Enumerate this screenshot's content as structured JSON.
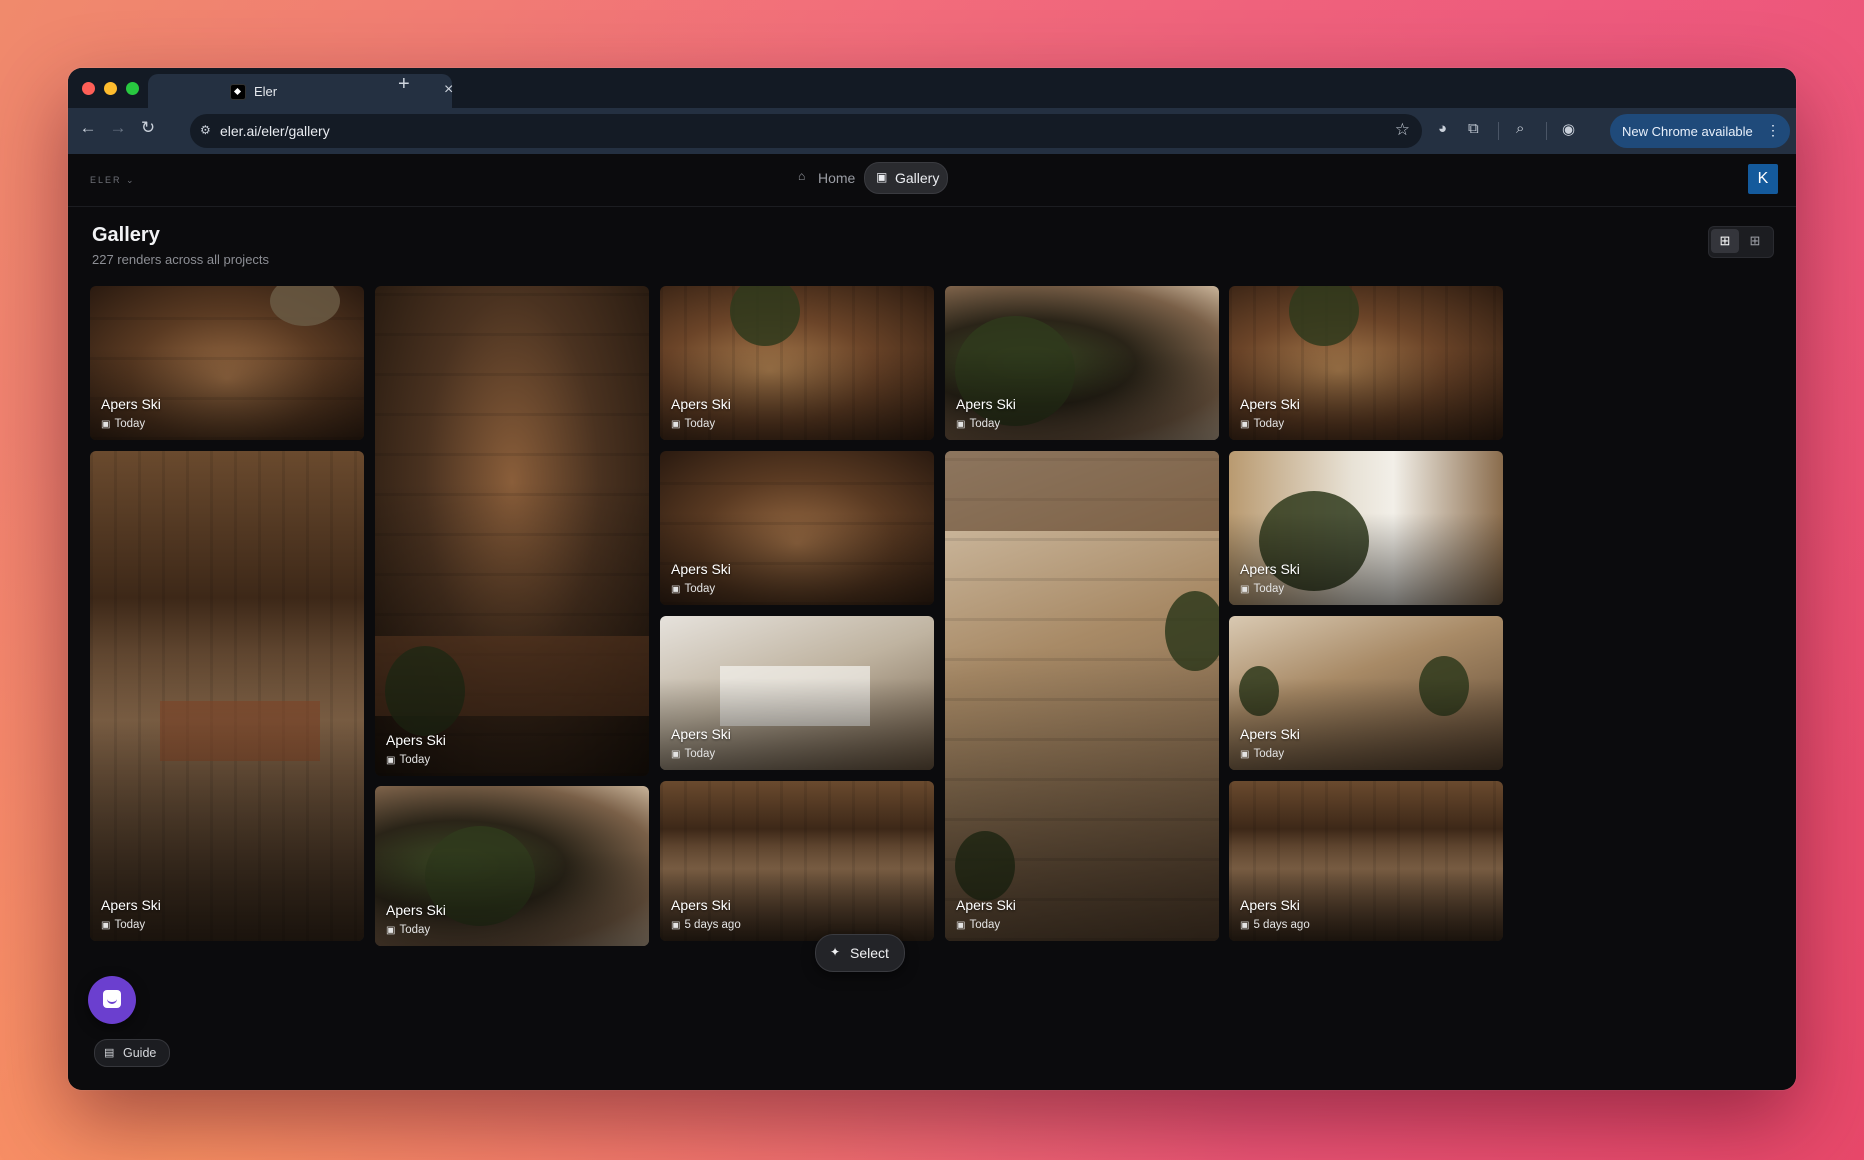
{
  "browser": {
    "tab_title": "Eler",
    "url": "eler.ai/eler/gallery",
    "update_label": "New Chrome available"
  },
  "appbar": {
    "brand": "ELER",
    "nav_home": "Home",
    "nav_gallery": "Gallery",
    "avatar_initial": "K"
  },
  "page": {
    "title": "Gallery",
    "subtitle": "227 renders across all projects"
  },
  "cards": [
    {
      "title": "Apers Ski",
      "date": "Today"
    },
    {
      "title": "Apers Ski",
      "date": "Today"
    },
    {
      "title": "Apers Ski",
      "date": "Today"
    },
    {
      "title": "Apers Ski",
      "date": "Today"
    },
    {
      "title": "Apers Ski",
      "date": "Today"
    },
    {
      "title": "Apers Ski",
      "date": "Today"
    },
    {
      "title": "Apers Ski",
      "date": "Today"
    },
    {
      "title": "Apers Ski",
      "date": "Today"
    },
    {
      "title": "Apers Ski",
      "date": "Today"
    },
    {
      "title": "Apers Ski",
      "date": "Today"
    },
    {
      "title": "Apers Ski",
      "date": "Today"
    },
    {
      "title": "Apers Ski",
      "date": "5 days ago"
    },
    {
      "title": "Apers Ski",
      "date": "Today"
    },
    {
      "title": "Apers Ski",
      "date": "5 days ago"
    }
  ],
  "floating": {
    "select_label": "Select",
    "guide_label": "Guide"
  }
}
